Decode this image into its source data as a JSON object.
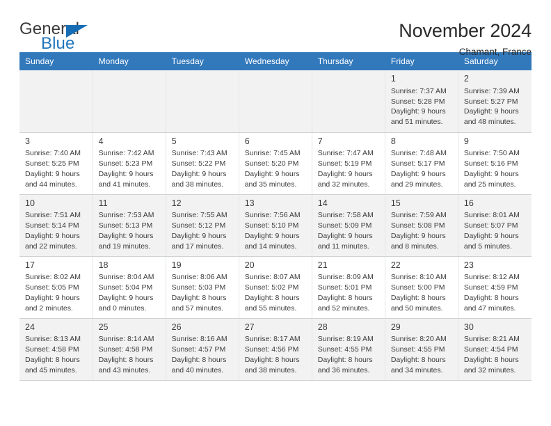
{
  "brand": {
    "name_part1": "General",
    "name_part2": "Blue",
    "flag_icon": "triangle-flag-icon",
    "accent_color": "#2175bb"
  },
  "header": {
    "title": "November 2024",
    "location": "Chamant, France"
  },
  "calendar": {
    "header_bg": "#3279bc",
    "weekday_headers": [
      "Sunday",
      "Monday",
      "Tuesday",
      "Wednesday",
      "Thursday",
      "Friday",
      "Saturday"
    ],
    "weeks": [
      [
        {
          "day": "",
          "empty": true
        },
        {
          "day": "",
          "empty": true
        },
        {
          "day": "",
          "empty": true
        },
        {
          "day": "",
          "empty": true
        },
        {
          "day": "",
          "empty": true
        },
        {
          "day": "1",
          "sunrise": "Sunrise: 7:37 AM",
          "sunset": "Sunset: 5:28 PM",
          "daylight_line1": "Daylight: 9 hours",
          "daylight_line2": "and 51 minutes."
        },
        {
          "day": "2",
          "sunrise": "Sunrise: 7:39 AM",
          "sunset": "Sunset: 5:27 PM",
          "daylight_line1": "Daylight: 9 hours",
          "daylight_line2": "and 48 minutes."
        }
      ],
      [
        {
          "day": "3",
          "sunrise": "Sunrise: 7:40 AM",
          "sunset": "Sunset: 5:25 PM",
          "daylight_line1": "Daylight: 9 hours",
          "daylight_line2": "and 44 minutes."
        },
        {
          "day": "4",
          "sunrise": "Sunrise: 7:42 AM",
          "sunset": "Sunset: 5:23 PM",
          "daylight_line1": "Daylight: 9 hours",
          "daylight_line2": "and 41 minutes."
        },
        {
          "day": "5",
          "sunrise": "Sunrise: 7:43 AM",
          "sunset": "Sunset: 5:22 PM",
          "daylight_line1": "Daylight: 9 hours",
          "daylight_line2": "and 38 minutes."
        },
        {
          "day": "6",
          "sunrise": "Sunrise: 7:45 AM",
          "sunset": "Sunset: 5:20 PM",
          "daylight_line1": "Daylight: 9 hours",
          "daylight_line2": "and 35 minutes."
        },
        {
          "day": "7",
          "sunrise": "Sunrise: 7:47 AM",
          "sunset": "Sunset: 5:19 PM",
          "daylight_line1": "Daylight: 9 hours",
          "daylight_line2": "and 32 minutes."
        },
        {
          "day": "8",
          "sunrise": "Sunrise: 7:48 AM",
          "sunset": "Sunset: 5:17 PM",
          "daylight_line1": "Daylight: 9 hours",
          "daylight_line2": "and 29 minutes."
        },
        {
          "day": "9",
          "sunrise": "Sunrise: 7:50 AM",
          "sunset": "Sunset: 5:16 PM",
          "daylight_line1": "Daylight: 9 hours",
          "daylight_line2": "and 25 minutes."
        }
      ],
      [
        {
          "day": "10",
          "sunrise": "Sunrise: 7:51 AM",
          "sunset": "Sunset: 5:14 PM",
          "daylight_line1": "Daylight: 9 hours",
          "daylight_line2": "and 22 minutes."
        },
        {
          "day": "11",
          "sunrise": "Sunrise: 7:53 AM",
          "sunset": "Sunset: 5:13 PM",
          "daylight_line1": "Daylight: 9 hours",
          "daylight_line2": "and 19 minutes."
        },
        {
          "day": "12",
          "sunrise": "Sunrise: 7:55 AM",
          "sunset": "Sunset: 5:12 PM",
          "daylight_line1": "Daylight: 9 hours",
          "daylight_line2": "and 17 minutes."
        },
        {
          "day": "13",
          "sunrise": "Sunrise: 7:56 AM",
          "sunset": "Sunset: 5:10 PM",
          "daylight_line1": "Daylight: 9 hours",
          "daylight_line2": "and 14 minutes."
        },
        {
          "day": "14",
          "sunrise": "Sunrise: 7:58 AM",
          "sunset": "Sunset: 5:09 PM",
          "daylight_line1": "Daylight: 9 hours",
          "daylight_line2": "and 11 minutes."
        },
        {
          "day": "15",
          "sunrise": "Sunrise: 7:59 AM",
          "sunset": "Sunset: 5:08 PM",
          "daylight_line1": "Daylight: 9 hours",
          "daylight_line2": "and 8 minutes."
        },
        {
          "day": "16",
          "sunrise": "Sunrise: 8:01 AM",
          "sunset": "Sunset: 5:07 PM",
          "daylight_line1": "Daylight: 9 hours",
          "daylight_line2": "and 5 minutes."
        }
      ],
      [
        {
          "day": "17",
          "sunrise": "Sunrise: 8:02 AM",
          "sunset": "Sunset: 5:05 PM",
          "daylight_line1": "Daylight: 9 hours",
          "daylight_line2": "and 2 minutes."
        },
        {
          "day": "18",
          "sunrise": "Sunrise: 8:04 AM",
          "sunset": "Sunset: 5:04 PM",
          "daylight_line1": "Daylight: 9 hours",
          "daylight_line2": "and 0 minutes."
        },
        {
          "day": "19",
          "sunrise": "Sunrise: 8:06 AM",
          "sunset": "Sunset: 5:03 PM",
          "daylight_line1": "Daylight: 8 hours",
          "daylight_line2": "and 57 minutes."
        },
        {
          "day": "20",
          "sunrise": "Sunrise: 8:07 AM",
          "sunset": "Sunset: 5:02 PM",
          "daylight_line1": "Daylight: 8 hours",
          "daylight_line2": "and 55 minutes."
        },
        {
          "day": "21",
          "sunrise": "Sunrise: 8:09 AM",
          "sunset": "Sunset: 5:01 PM",
          "daylight_line1": "Daylight: 8 hours",
          "daylight_line2": "and 52 minutes."
        },
        {
          "day": "22",
          "sunrise": "Sunrise: 8:10 AM",
          "sunset": "Sunset: 5:00 PM",
          "daylight_line1": "Daylight: 8 hours",
          "daylight_line2": "and 50 minutes."
        },
        {
          "day": "23",
          "sunrise": "Sunrise: 8:12 AM",
          "sunset": "Sunset: 4:59 PM",
          "daylight_line1": "Daylight: 8 hours",
          "daylight_line2": "and 47 minutes."
        }
      ],
      [
        {
          "day": "24",
          "sunrise": "Sunrise: 8:13 AM",
          "sunset": "Sunset: 4:58 PM",
          "daylight_line1": "Daylight: 8 hours",
          "daylight_line2": "and 45 minutes."
        },
        {
          "day": "25",
          "sunrise": "Sunrise: 8:14 AM",
          "sunset": "Sunset: 4:58 PM",
          "daylight_line1": "Daylight: 8 hours",
          "daylight_line2": "and 43 minutes."
        },
        {
          "day": "26",
          "sunrise": "Sunrise: 8:16 AM",
          "sunset": "Sunset: 4:57 PM",
          "daylight_line1": "Daylight: 8 hours",
          "daylight_line2": "and 40 minutes."
        },
        {
          "day": "27",
          "sunrise": "Sunrise: 8:17 AM",
          "sunset": "Sunset: 4:56 PM",
          "daylight_line1": "Daylight: 8 hours",
          "daylight_line2": "and 38 minutes."
        },
        {
          "day": "28",
          "sunrise": "Sunrise: 8:19 AM",
          "sunset": "Sunset: 4:55 PM",
          "daylight_line1": "Daylight: 8 hours",
          "daylight_line2": "and 36 minutes."
        },
        {
          "day": "29",
          "sunrise": "Sunrise: 8:20 AM",
          "sunset": "Sunset: 4:55 PM",
          "daylight_line1": "Daylight: 8 hours",
          "daylight_line2": "and 34 minutes."
        },
        {
          "day": "30",
          "sunrise": "Sunrise: 8:21 AM",
          "sunset": "Sunset: 4:54 PM",
          "daylight_line1": "Daylight: 8 hours",
          "daylight_line2": "and 32 minutes."
        }
      ]
    ]
  }
}
